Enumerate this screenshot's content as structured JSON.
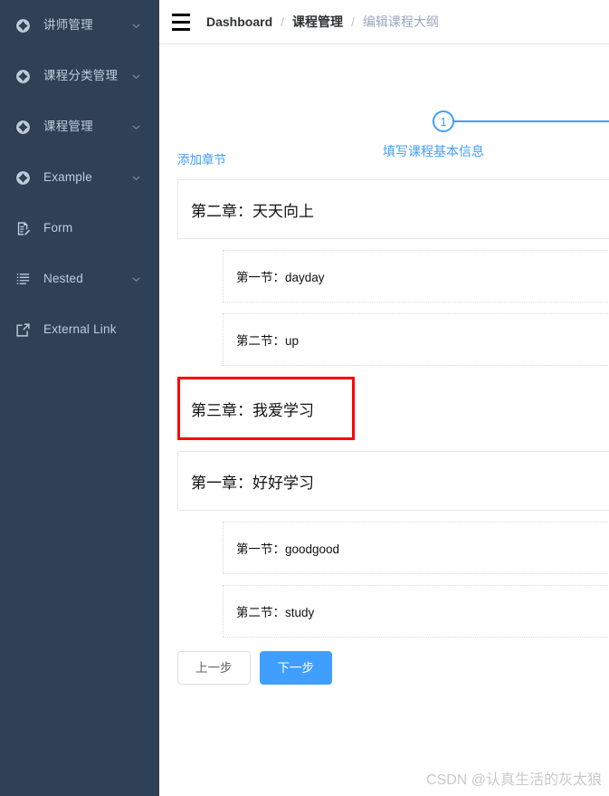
{
  "sidebar": {
    "bg_color": "#304156",
    "text_color": "#bfcbd9",
    "items": [
      {
        "label": "讲师管理",
        "icon": "component-icon",
        "has_arrow": true
      },
      {
        "label": "课程分类管理",
        "icon": "component-icon",
        "has_arrow": true
      },
      {
        "label": "课程管理",
        "icon": "component-icon",
        "has_arrow": true
      },
      {
        "label": "Example",
        "icon": "component-icon",
        "has_arrow": true
      },
      {
        "label": "Form",
        "icon": "form-icon",
        "has_arrow": false
      },
      {
        "label": "Nested",
        "icon": "nested-list-icon",
        "has_arrow": true
      },
      {
        "label": "External Link",
        "icon": "external-link-icon",
        "has_arrow": false
      }
    ]
  },
  "navbar": {
    "hamburger_icon": "hamburger-icon",
    "breadcrumb": [
      {
        "label": "Dashboard",
        "current": false
      },
      {
        "label": "课程管理",
        "current": false
      },
      {
        "label": "编辑课程大纲",
        "current": true
      }
    ],
    "separator": "/"
  },
  "steps": {
    "accent_color": "#409eff",
    "active_index": 1,
    "items": [
      {
        "number": "1",
        "title": "填写课程基本信息"
      }
    ]
  },
  "outline": {
    "add_chapter_label": "添加章节",
    "highlight_color": "#ff0000",
    "chapters": [
      {
        "title": "第二章：天天向上",
        "highlighted": false,
        "sections": [
          {
            "title": "第一节：dayday"
          },
          {
            "title": "第二节：up"
          }
        ]
      },
      {
        "title": "第三章：我爱学习",
        "highlighted": true,
        "sections": []
      },
      {
        "title": "第一章：好好学习",
        "highlighted": false,
        "sections": [
          {
            "title": "第一节：goodgood"
          },
          {
            "title": "第二节：study"
          }
        ]
      }
    ]
  },
  "footer": {
    "prev_label": "上一步",
    "next_label": "下一步"
  },
  "watermark": {
    "text": "CSDN @认真生活的灰太狼"
  }
}
